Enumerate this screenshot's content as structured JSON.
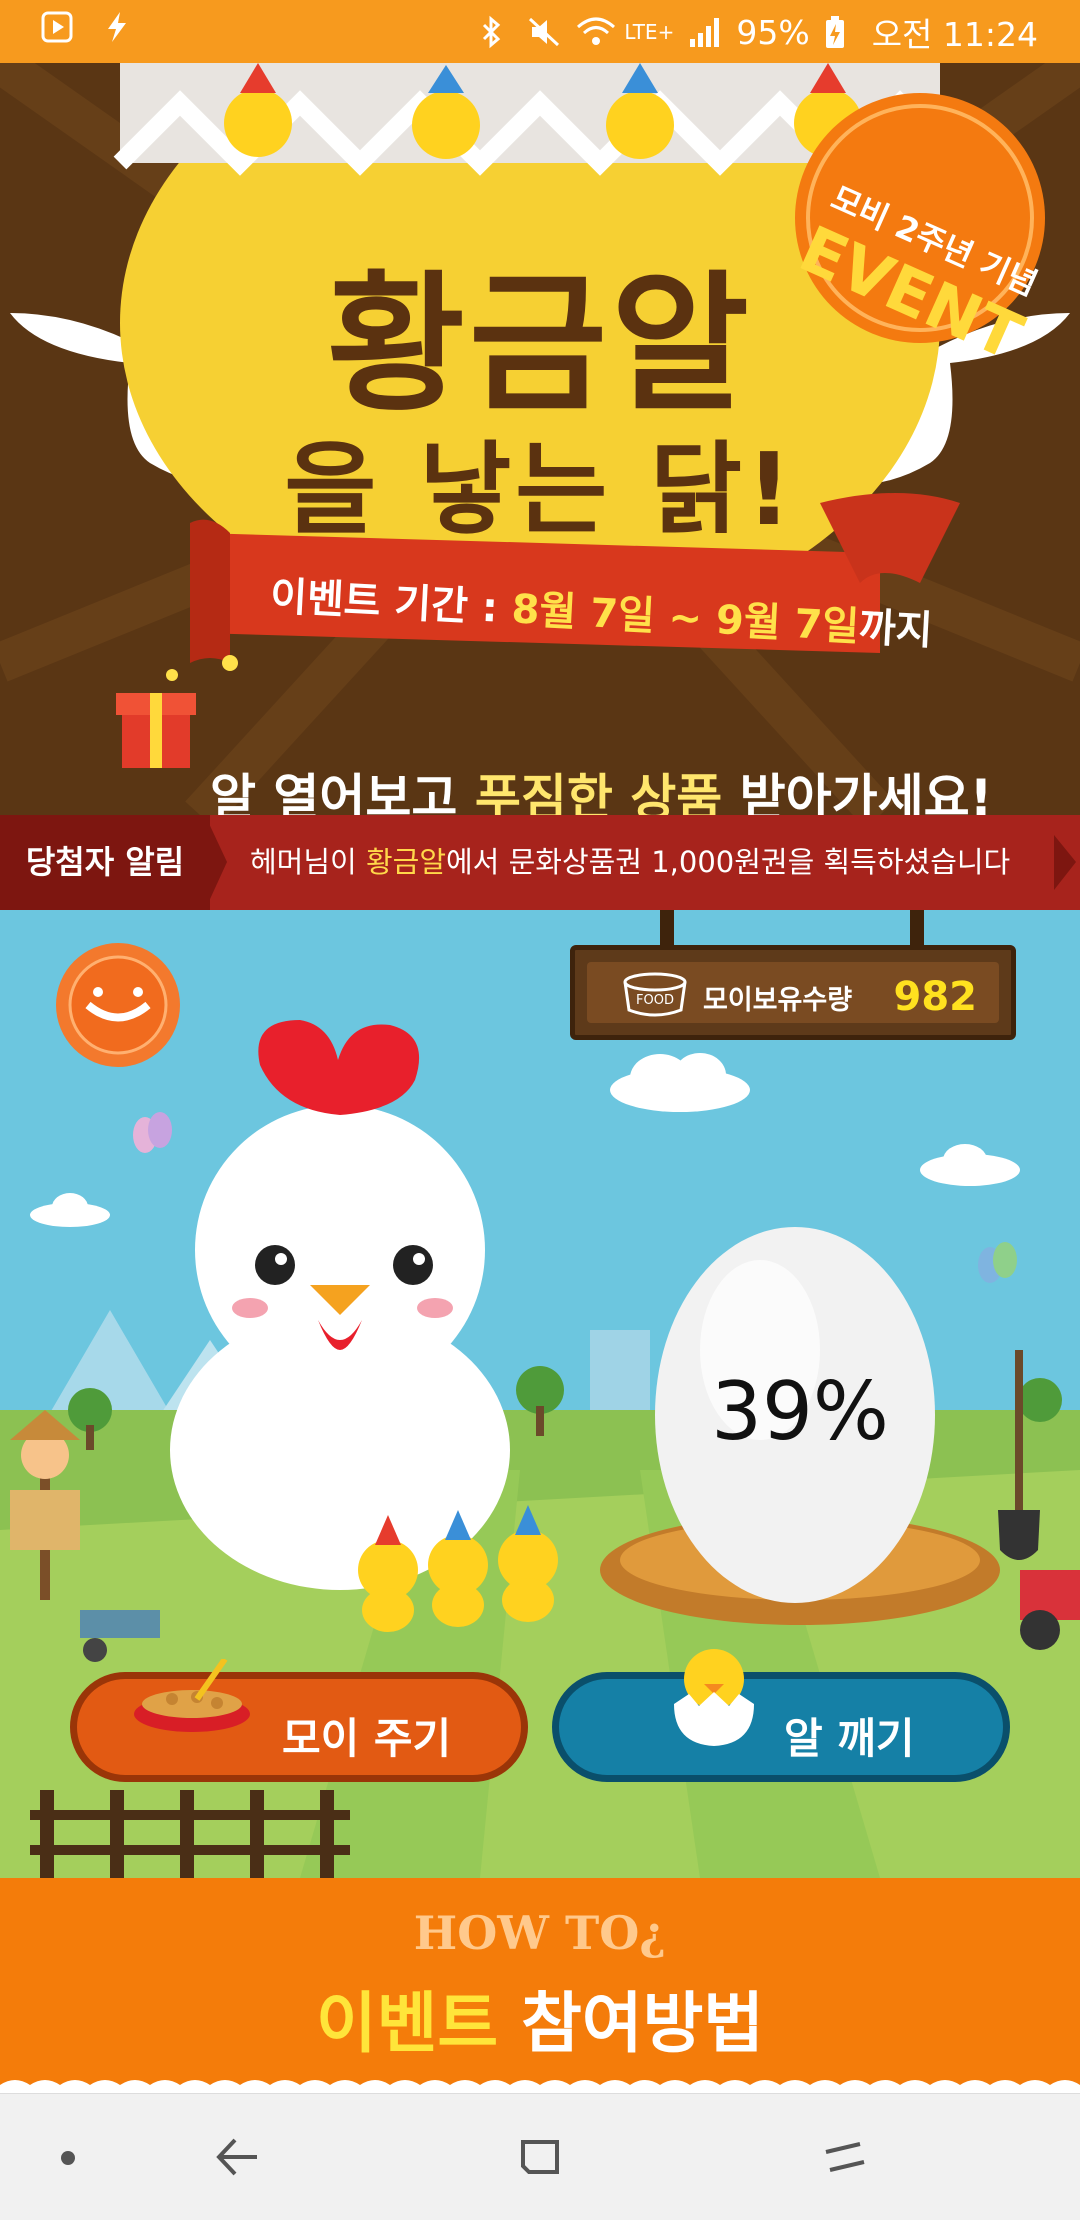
{
  "status_bar": {
    "battery": "95%",
    "network": "LTE+",
    "time": "오전 11:24",
    "icons": [
      "media-icon",
      "flash-icon",
      "bluetooth-icon",
      "mute-icon",
      "wifi-icon",
      "signal-icon",
      "battery-icon"
    ]
  },
  "banner": {
    "title_line1": "황금알",
    "title_line2": "을 낳는 닭!",
    "period_prefix": "이벤트 기간 : ",
    "period_dates": "8월 7일 ~ 9월 7일",
    "period_suffix": "까지",
    "subtitle_prefix": "알 열어보고 ",
    "subtitle_highlight": "푸짐한 상품",
    "subtitle_suffix": " 받아가세요!",
    "badge_line1": "모비 2주년 기념",
    "badge_line2": "EVENT"
  },
  "winner_bar": {
    "label": "당첨자 알림",
    "msg_prefix": "헤머님이 ",
    "msg_highlight": "황금알",
    "msg_suffix": "에서 문화상품권 1,000원권을 획득하셨습니다"
  },
  "game": {
    "food_icon_text": "FOOD",
    "food_label": "모이보유수량",
    "food_count": "982",
    "egg_progress": "39%",
    "egg_progress_value": 0.39,
    "feed_button": "모이 주기",
    "break_button": "알 깨기"
  },
  "howto": {
    "title_en": "HOW TO¿",
    "title_highlight": "이벤트",
    "title_rest": " 참여방법"
  },
  "colors": {
    "status_bar": "#f79a1e",
    "banner_bg": "#5a3614",
    "winner_bar": "#a7231c",
    "sky": "#6cc6df",
    "grass": "#8cc152",
    "feed_button": "#e25a13",
    "break_button": "#1580a6",
    "howto_bg": "#f47c0a"
  }
}
